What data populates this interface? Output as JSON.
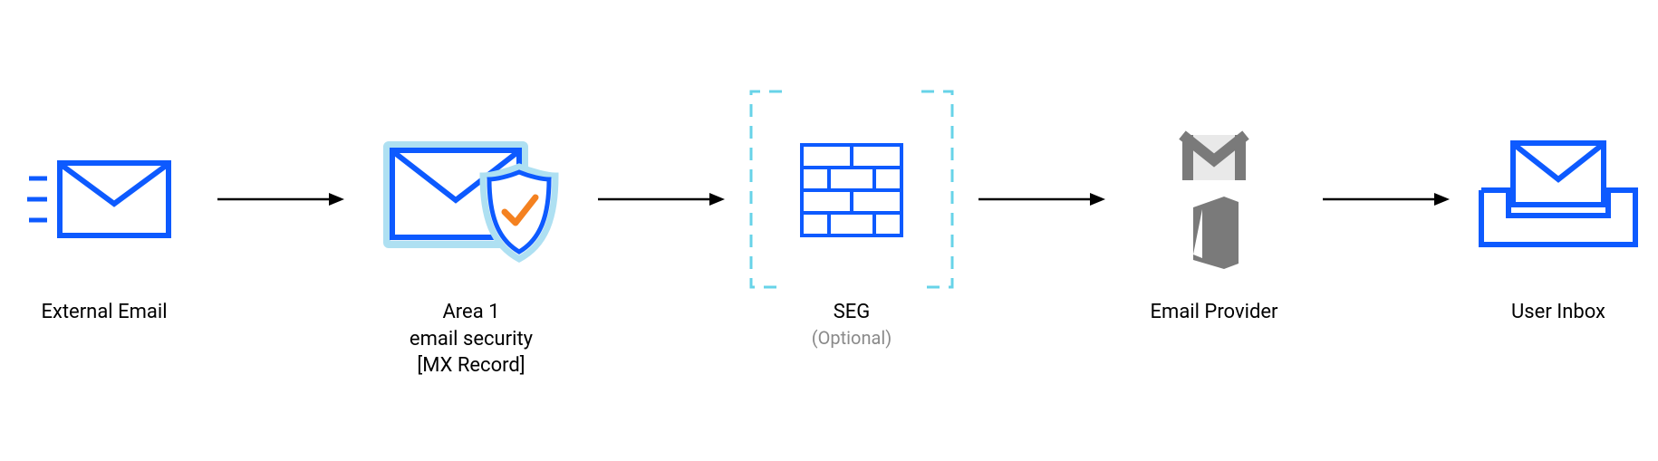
{
  "diagram": {
    "nodes": {
      "external_email": {
        "label": "External Email"
      },
      "area1": {
        "line1": "Area 1",
        "line2": "email security",
        "line3": "[MX Record]"
      },
      "seg": {
        "label": "SEG",
        "sub": "(Optional)"
      },
      "provider": {
        "label": "Email Provider"
      },
      "inbox": {
        "label": "User Inbox"
      }
    },
    "colors": {
      "stroke_blue": "#0D5AFF",
      "light_blue_fill": "#E6F2FA",
      "light_blue_stroke": "#AEE0F2",
      "light_teal": "#9EE0F0",
      "orange": "#F48120",
      "arrow": "#000000",
      "gray_icon": "#7A7A7A",
      "gray_text": "#8A8A8A"
    }
  }
}
